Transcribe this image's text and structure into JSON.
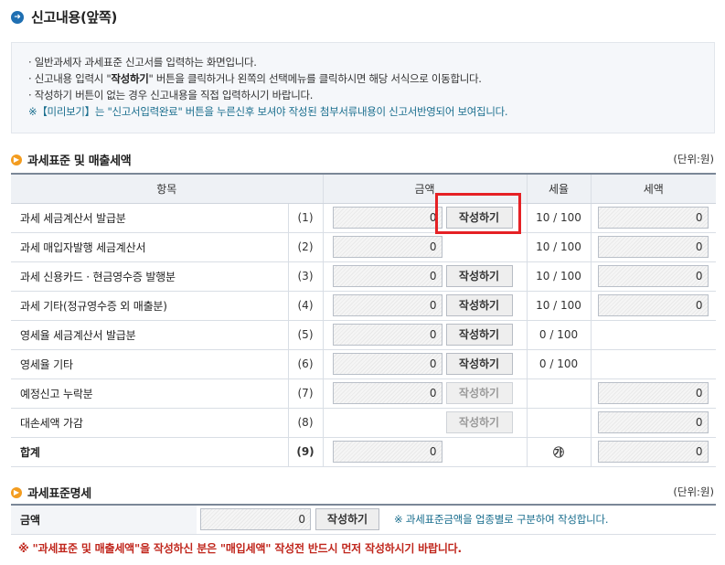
{
  "header": {
    "title": "신고내용(앞쪽)",
    "icon": "circle-arrow-right-icon"
  },
  "info": {
    "lines": [
      {
        "text": "일반과세자 과세표준 신고서를 입력하는 화면입니다."
      },
      {
        "pre": "신고내용 입력시 \"",
        "strong": "작성하기",
        "post": "\" 버튼을 클릭하거나 왼쪽의 선택메뉴를 클릭하시면 해당 서식으로 이동합니다."
      },
      {
        "text": "작성하기 버튼이 없는 경우 신고내용을 직접 입력하시기 바랍니다."
      }
    ],
    "bullet": "·",
    "note": "※【미리보기】는 \"신고서입력완료\" 버튼을 누른신후 보셔야 작성된 첨부서류내용이 신고서반영되어 보여집니다."
  },
  "section1": {
    "title": "과세표준 및 매출세액",
    "unit": "(단위:원)",
    "columns": {
      "item": "항목",
      "amount": "금액",
      "rate": "세율",
      "tax": "세액"
    },
    "write_label": "작성하기",
    "rows": [
      {
        "label": "과세 세금계산서 발급분",
        "num": "(1)",
        "amount": "0",
        "rate": "10 / 100",
        "tax": "0"
      },
      {
        "label": "과세 매입자발행 세금계산서",
        "num": "(2)",
        "amount": "0",
        "rate": "10 / 100",
        "tax": "0"
      },
      {
        "label": "과세 신용카드 · 현금영수증 발행분",
        "num": "(3)",
        "amount": "0",
        "rate": "10 / 100",
        "tax": "0"
      },
      {
        "label": "과세 기타(정규영수증 외 매출분)",
        "num": "(4)",
        "amount": "0",
        "rate": "10 / 100",
        "tax": "0"
      },
      {
        "label": "영세율 세금계산서 발급분",
        "num": "(5)",
        "amount": "0",
        "rate": "0 / 100"
      },
      {
        "label": "영세율 기타",
        "num": "(6)",
        "amount": "0",
        "rate": "0 / 100"
      },
      {
        "label": "예정신고 누락분",
        "num": "(7)",
        "amount": "0",
        "tax": "0"
      },
      {
        "label": "대손세액 가감",
        "num": "(8)",
        "tax": "0"
      },
      {
        "label": "합계",
        "num": "(9)",
        "amount": "0",
        "rate_symbol": "㉮",
        "tax": "0"
      }
    ]
  },
  "section2": {
    "title": "과세표준명세",
    "unit": "(단위:원)",
    "row_label": "금액",
    "amount": "0",
    "button": "작성하기",
    "note": "※ 과세표준금액을 업종별로 구분하여 작성합니다."
  },
  "warning": "※ \"과세표준 및 매출세액\"을 작성하신 분은 \"매입세액\" 작성전 반드시 먼저 작성하시기 바랍니다.",
  "colors": {
    "highlight": "#e52125",
    "accent": "#1f6fb2",
    "section_dot": "#f39c1f",
    "warning": "#c0261c",
    "note": "#1a6e8e"
  }
}
